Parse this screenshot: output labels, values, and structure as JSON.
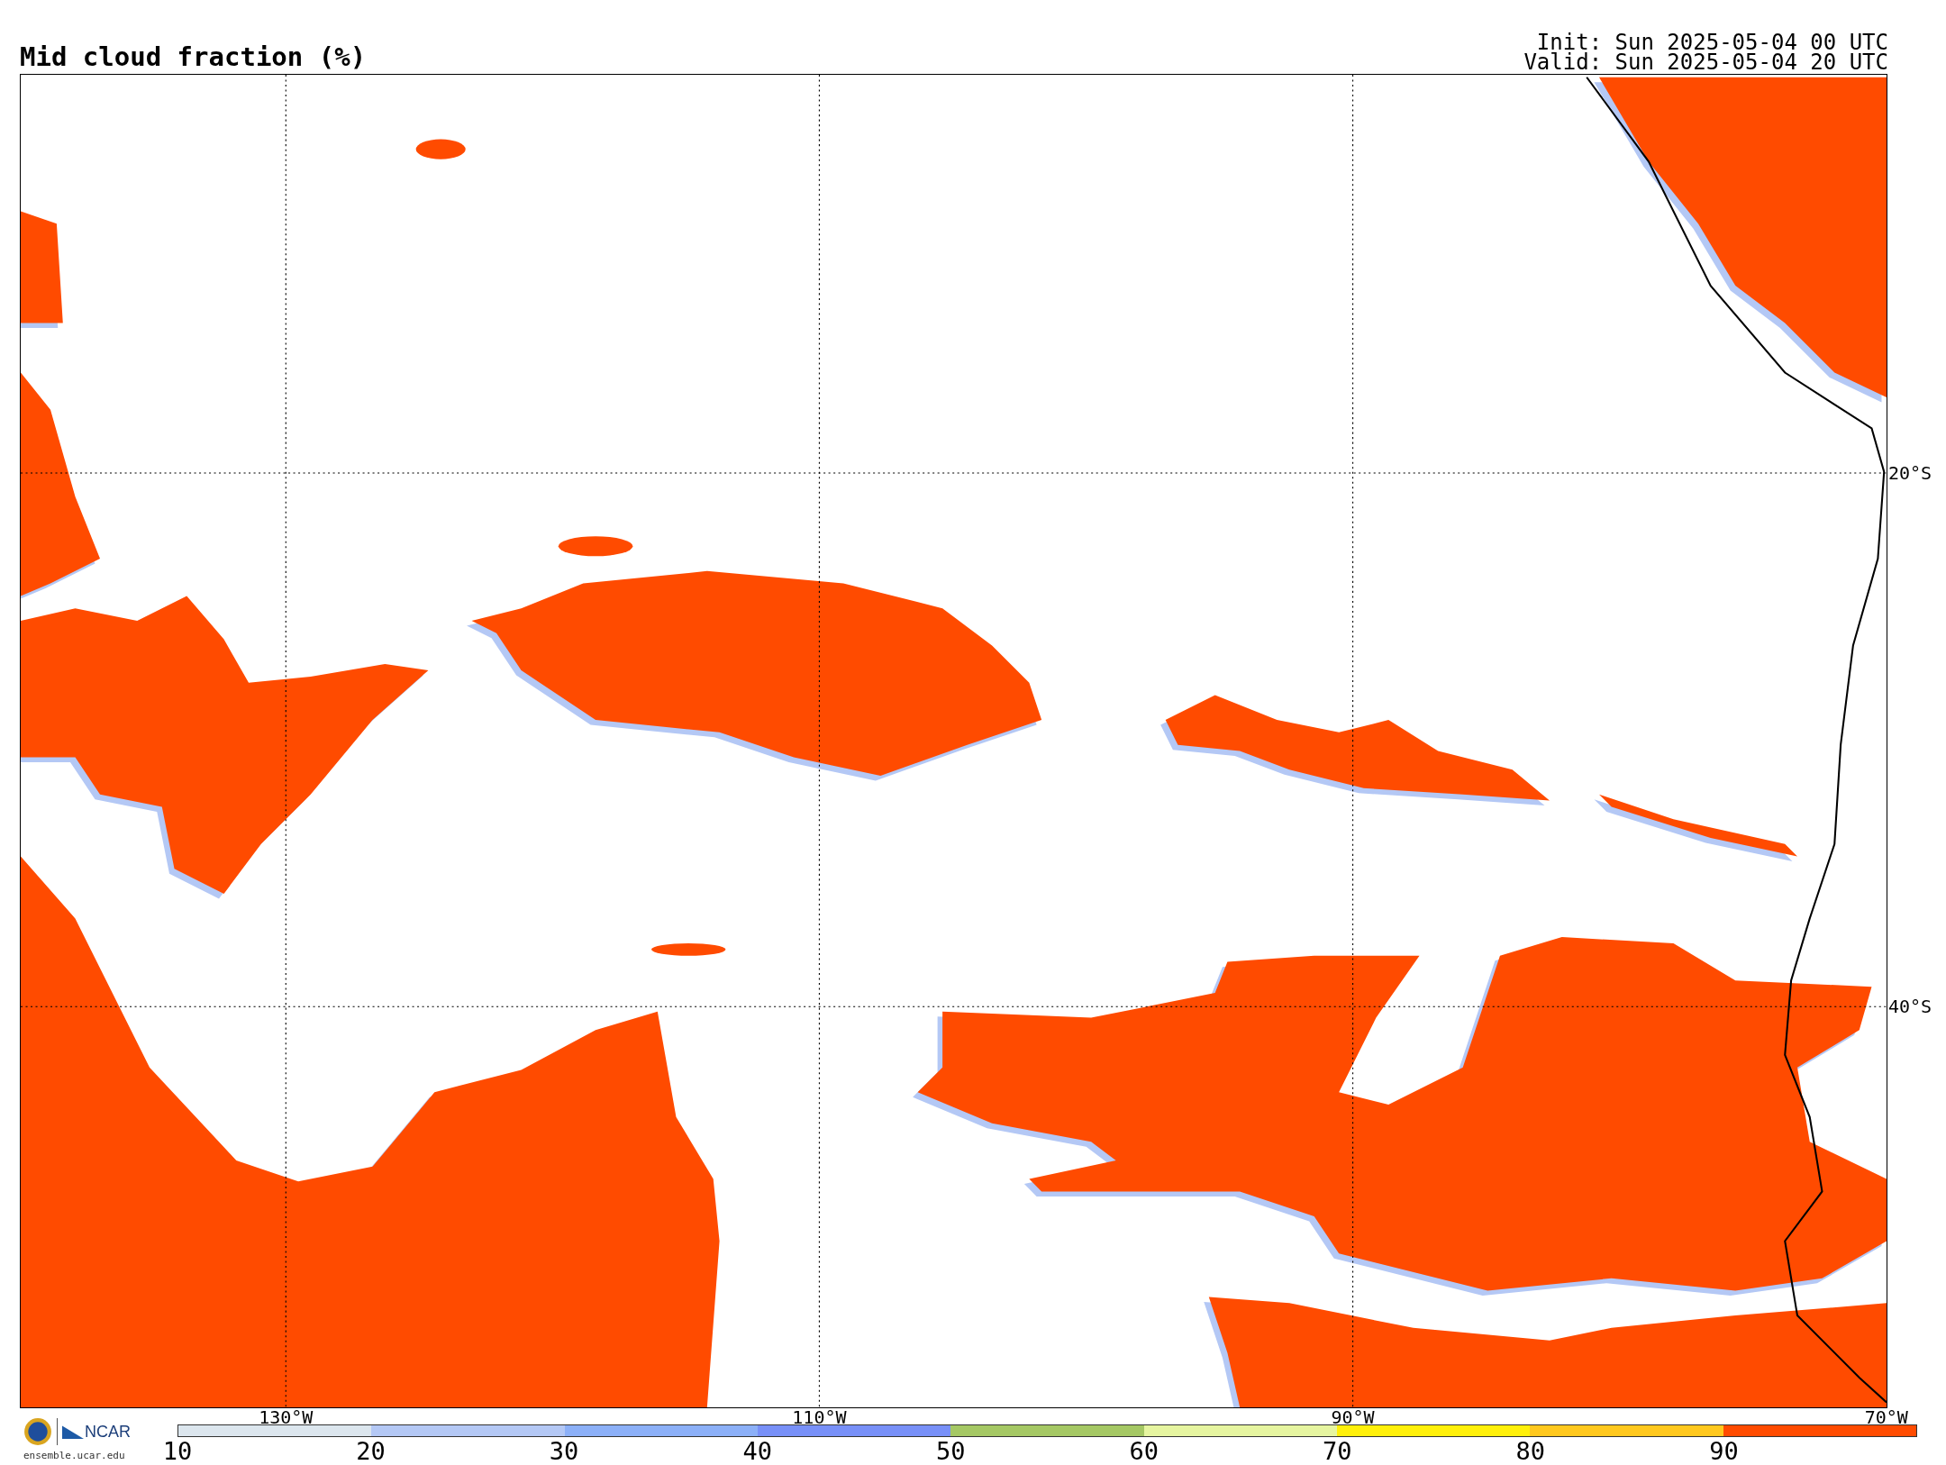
{
  "title": "Mid cloud fraction (%)",
  "init": "Init: Sun 2025-05-04 00 UTC",
  "valid": "Valid: Sun 2025-05-04 20 UTC",
  "map": {
    "longitude_labels": [
      "130°W",
      "110°W",
      "90°W",
      "70°W"
    ],
    "latitude_labels": [
      "20°S",
      "40°S"
    ]
  },
  "colorbar": {
    "bins": [
      {
        "color": "#dce6ee"
      },
      {
        "color": "#b4c8f5"
      },
      {
        "color": "#8cb0f8"
      },
      {
        "color": "#7890f8"
      },
      {
        "color": "#a5c864"
      },
      {
        "color": "#e6f5a0"
      },
      {
        "color": "#fff00a"
      },
      {
        "color": "#ffc81e"
      },
      {
        "color": "#ff4b00"
      }
    ],
    "ticks": [
      "10",
      "20",
      "30",
      "40",
      "50",
      "60",
      "70",
      "80",
      "90"
    ]
  },
  "footer": {
    "logo_text": "NCAR",
    "site": "ensemble.ucar.edu"
  }
}
